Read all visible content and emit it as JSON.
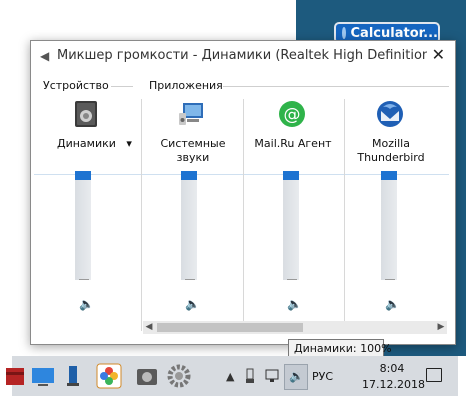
{
  "background_app": {
    "button_label": "Calculator..."
  },
  "window": {
    "title": "Микшер громкости - Динамики (Realtek High Definition ...",
    "close_label": "✕"
  },
  "device_group": {
    "label": "Устройство",
    "device_name": "Динамики",
    "level": 1.0,
    "muted": false
  },
  "apps_group": {
    "label": "Приложения"
  },
  "apps": [
    {
      "line1": "Системные",
      "line2": "звуки",
      "level": 1.0,
      "muted": false
    },
    {
      "line1": "Mail.Ru Агент",
      "line2": "",
      "level": 1.0,
      "muted": false
    },
    {
      "line1": "Mozilla",
      "line2": "Thunderbird",
      "level": 1.0,
      "muted": false
    }
  ],
  "scrollbar": {
    "left_arrow": "◀",
    "right_arrow": "▶"
  },
  "tooltip": {
    "text": "Динамики: 100%"
  },
  "taskbar": {
    "up_arrow": "▲",
    "language": "РУС",
    "time": "8:04",
    "date": "17.12.2018"
  },
  "colors": {
    "accent": "#1e73d1",
    "desktop": "#1d5a7e",
    "calculator": "#1565c0",
    "taskbar": "#d7dbe0"
  }
}
